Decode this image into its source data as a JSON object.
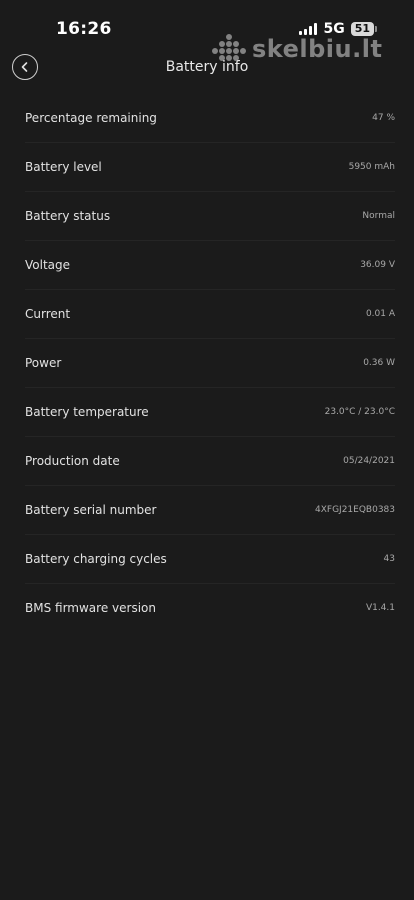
{
  "status_bar": {
    "time": "16:26",
    "network": "5G",
    "battery": "51"
  },
  "watermark": {
    "text": "skelbiu.lt"
  },
  "header": {
    "title": "Battery info",
    "back_icon": "chevron-left-icon"
  },
  "rows": [
    {
      "label": "Percentage remaining",
      "value": "47 %"
    },
    {
      "label": "Battery level",
      "value": "5950 mAh"
    },
    {
      "label": "Battery status",
      "value": "Normal"
    },
    {
      "label": "Voltage",
      "value": "36.09 V"
    },
    {
      "label": "Current",
      "value": "0.01 A"
    },
    {
      "label": "Power",
      "value": "0.36 W"
    },
    {
      "label": "Battery temperature",
      "value": "23.0°C / 23.0°C"
    },
    {
      "label": "Production date",
      "value": "05/24/2021"
    },
    {
      "label": "Battery serial number",
      "value": "4XFGJ21EQB0383"
    },
    {
      "label": "Battery charging cycles",
      "value": "43"
    },
    {
      "label": "BMS firmware version",
      "value": "V1.4.1"
    }
  ],
  "colors": {
    "background": "#1b1b1b",
    "text": "#e2e2e2",
    "value_text": "#a8a8a8"
  }
}
